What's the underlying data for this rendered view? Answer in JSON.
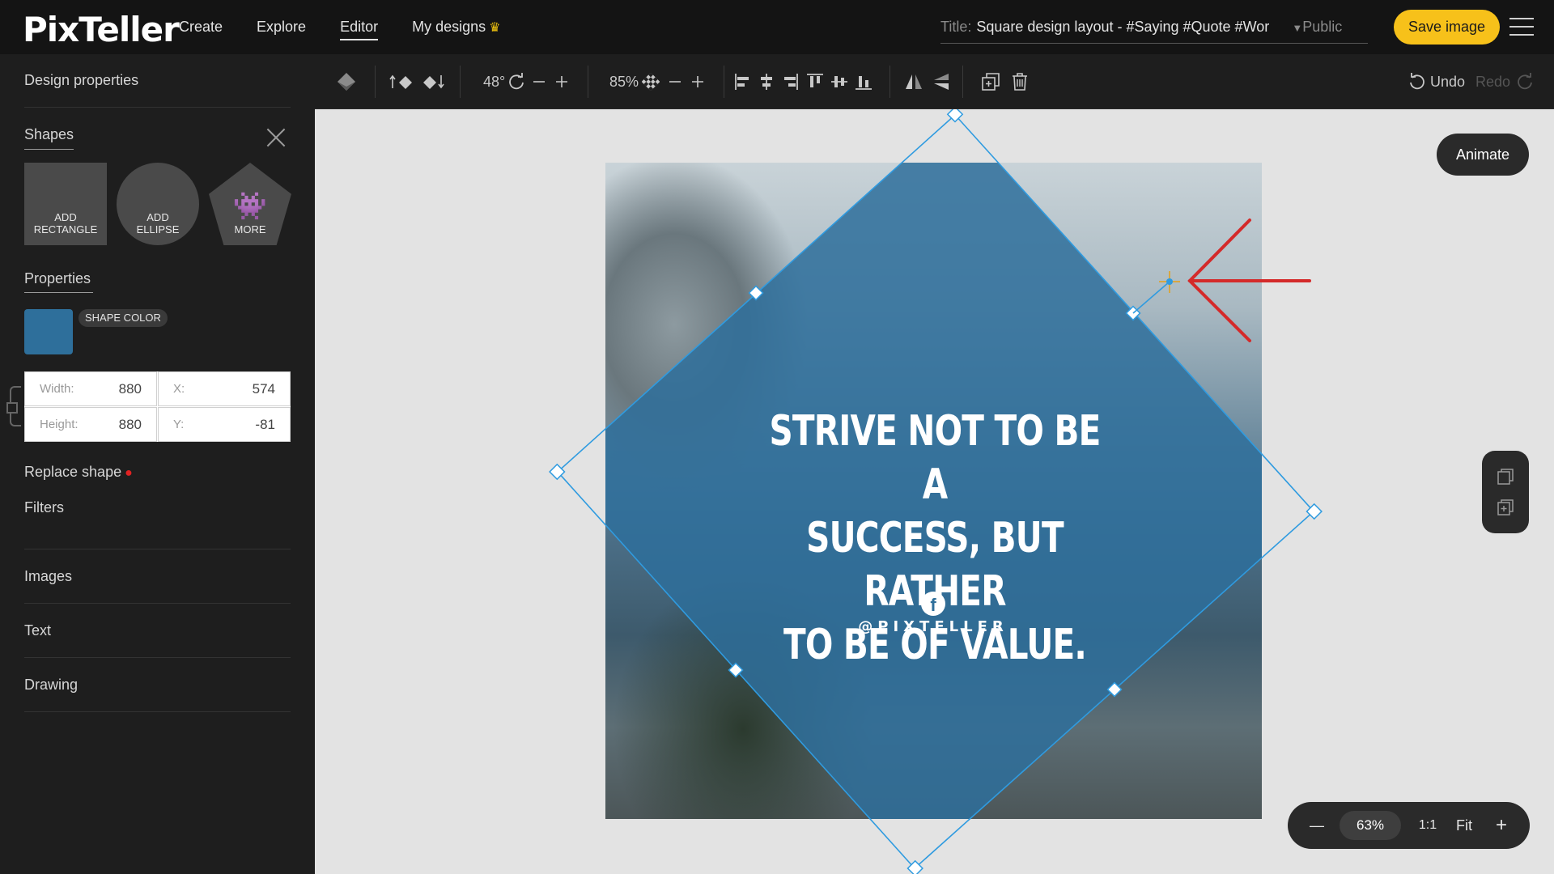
{
  "app": {
    "logo": "PixTeller"
  },
  "nav": {
    "items": [
      "Create",
      "Explore",
      "Editor",
      "My designs"
    ],
    "active": "Editor"
  },
  "header": {
    "title_label": "Title:",
    "title_value": "Square design layout - #Saying #Quote #Wor",
    "visibility": "Public",
    "save_label": "Save image"
  },
  "sidebar": {
    "design_properties": "Design properties",
    "shapes_title": "Shapes",
    "shape_buttons": {
      "rectangle": "ADD RECTANGLE",
      "ellipse": "ADD ELLIPSE",
      "more": "MORE"
    },
    "properties_title": "Properties",
    "shape_color_label": "SHAPE COLOR",
    "shape_color": "#2e6f9b",
    "width_label": "Width:",
    "width_value": "880",
    "height_label": "Height:",
    "height_value": "880",
    "x_label": "X:",
    "x_value": "574",
    "y_label": "Y:",
    "y_value": "-81",
    "replace_shape": "Replace shape",
    "filters": "Filters",
    "images": "Images",
    "text": "Text",
    "drawing": "Drawing"
  },
  "toolbar": {
    "rotation": "48°",
    "opacity": "85%",
    "undo": "Undo",
    "redo": "Redo"
  },
  "canvas": {
    "quote": "STRIVE NOT TO BE A\nSUCCESS, BUT RATHER\nTO BE OF VALUE.",
    "facebook_glyph": "f",
    "handle": "@PIXTELLER",
    "animate_label": "Animate"
  },
  "zoom": {
    "minus": "—",
    "level": "63%",
    "ratio": "1:1",
    "fit": "Fit",
    "plus": "+"
  },
  "colors": {
    "accent": "#f7c11a",
    "selection": "#2f9be0",
    "shape": "#2e6f9b",
    "annotation_arrow": "#d42a2a"
  }
}
